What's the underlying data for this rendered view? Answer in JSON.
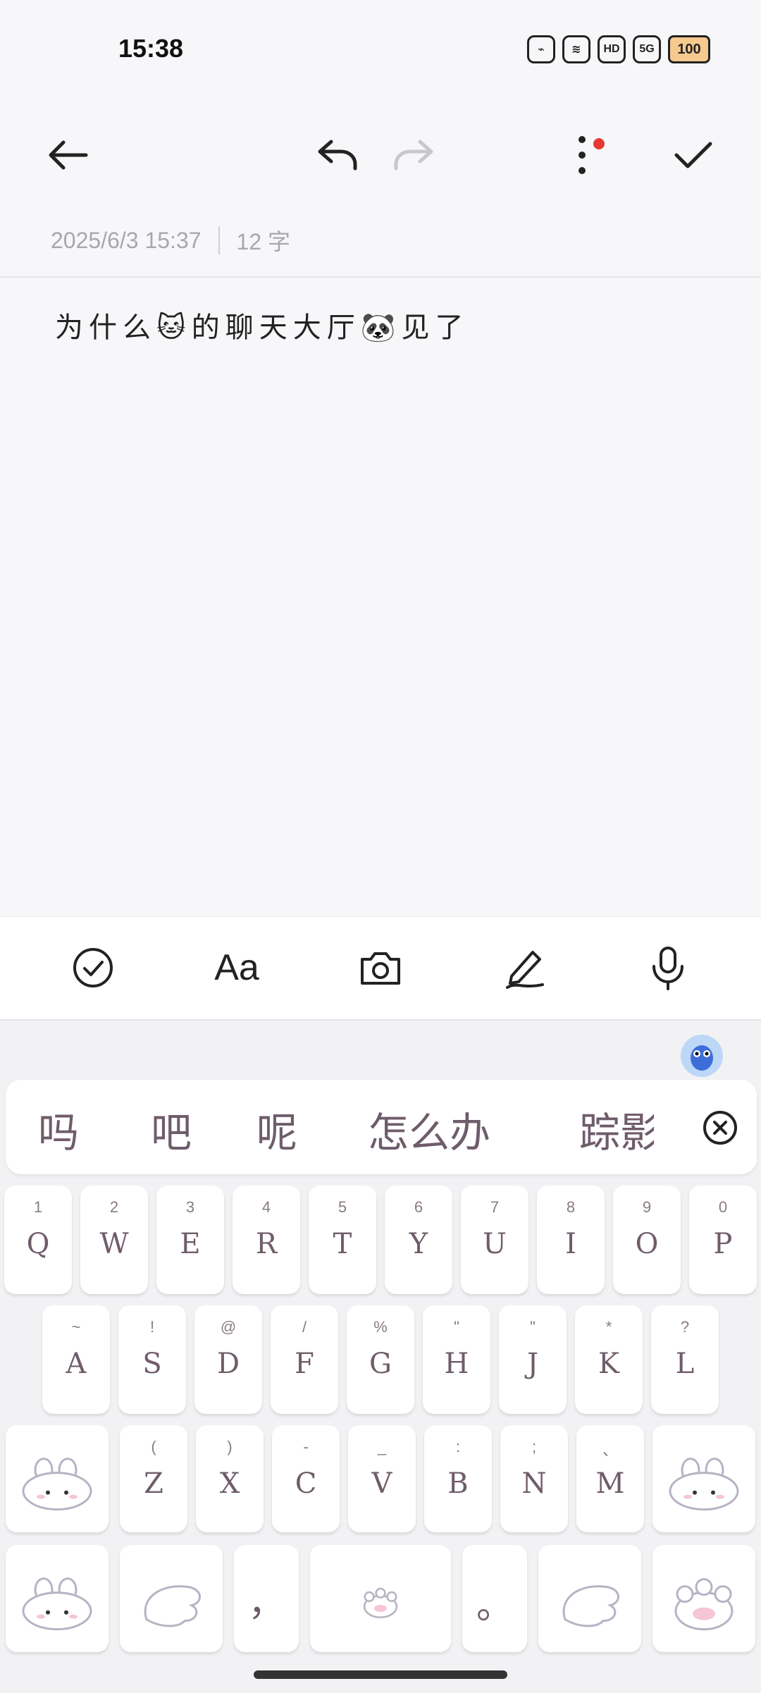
{
  "status": {
    "time": "15:38",
    "network": "5G",
    "battery": "100"
  },
  "toolbar": {
    "back": "back",
    "undo": "undo",
    "redo": "redo",
    "more": "more",
    "done": "done"
  },
  "note": {
    "datetime": "2025/6/3 15:37",
    "word_count": "12 字",
    "text": "为什么🐱的聊天大厅🐼见了"
  },
  "edit_tools": [
    "checklist",
    "text-format",
    "camera",
    "handwriting",
    "voice"
  ],
  "candidates": [
    "吗",
    "吧",
    "呢",
    "怎么办",
    "踪影"
  ],
  "rows": {
    "row1": [
      {
        "sub": "1",
        "main": "Q"
      },
      {
        "sub": "2",
        "main": "W"
      },
      {
        "sub": "3",
        "main": "E"
      },
      {
        "sub": "4",
        "main": "R"
      },
      {
        "sub": "5",
        "main": "T"
      },
      {
        "sub": "6",
        "main": "Y"
      },
      {
        "sub": "7",
        "main": "U"
      },
      {
        "sub": "8",
        "main": "I"
      },
      {
        "sub": "9",
        "main": "O"
      },
      {
        "sub": "0",
        "main": "P"
      }
    ],
    "row2": [
      {
        "sub": "~",
        "main": "A"
      },
      {
        "sub": "!",
        "main": "S"
      },
      {
        "sub": "@",
        "main": "D"
      },
      {
        "sub": "/",
        "main": "F"
      },
      {
        "sub": "%",
        "main": "G"
      },
      {
        "sub": "\"",
        "main": "H"
      },
      {
        "sub": "\"",
        "main": "J"
      },
      {
        "sub": "*",
        "main": "K"
      },
      {
        "sub": "?",
        "main": "L"
      }
    ],
    "row3": [
      {
        "sub": "(",
        "main": "Z"
      },
      {
        "sub": ")",
        "main": "X"
      },
      {
        "sub": "-",
        "main": "C"
      },
      {
        "sub": "_",
        "main": "V"
      },
      {
        "sub": ":",
        "main": "B"
      },
      {
        "sub": ";",
        "main": "N"
      },
      {
        "sub": "、",
        "main": "M"
      }
    ],
    "row4": {
      "comma": "，",
      "period": "。"
    }
  }
}
